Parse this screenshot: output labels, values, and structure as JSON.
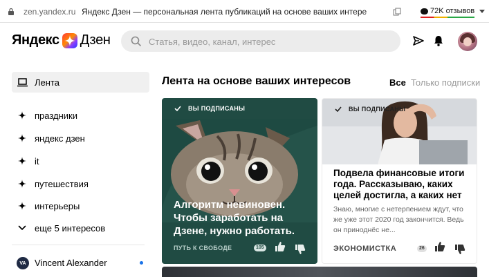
{
  "browser": {
    "url": "zen.yandex.ru",
    "page_title": "Яндекс Дзен — персональная лента публикаций на основе ваших интере",
    "reviews": "72K отзывов"
  },
  "header": {
    "logo_left": "Яндекс",
    "logo_right": "Дзен",
    "search_placeholder": "Статья, видео, канал, интерес"
  },
  "sidebar": {
    "items": [
      {
        "label": "Лента",
        "icon": "laptop-icon"
      },
      {
        "label": "праздники",
        "icon": "sparkle-icon"
      },
      {
        "label": "яндекс дзен",
        "icon": "sparkle-icon"
      },
      {
        "label": "it",
        "icon": "sparkle-icon"
      },
      {
        "label": "путешествия",
        "icon": "sparkle-icon"
      },
      {
        "label": "интерьеры",
        "icon": "sparkle-icon"
      },
      {
        "label": "еще 5 интересов",
        "icon": "chevron-down-icon"
      }
    ],
    "account": {
      "initials": "VA",
      "name": "Vincent Alexander"
    }
  },
  "main": {
    "title": "Лента на основе ваших интересов",
    "filters": {
      "all": "Все",
      "subscriptions": "Только подписки"
    },
    "cards": [
      {
        "badge": "ВЫ ПОДПИСАНЫ",
        "headline": "Алгоритм невиновен. Чтобы заработать на Дзене, нужно работать.",
        "source": "ПУТЬ К СВОБОДЕ",
        "count": "105"
      },
      {
        "badge": "ВЫ ПОДПИСАНЫ",
        "headline": "Подвела финансовые итоги года. Рассказываю, каких целей достигла, а каких нет",
        "snippet": "Знаю, многие с нетерпением ждут, что же уже этот 2020 год закончится. Ведь он приноднёс не...",
        "source": "ЭКОНОМИСТКА",
        "count": "26"
      }
    ]
  },
  "colors": {
    "card1_bg": "#204b43",
    "accent_blue": "#1a73e8"
  }
}
